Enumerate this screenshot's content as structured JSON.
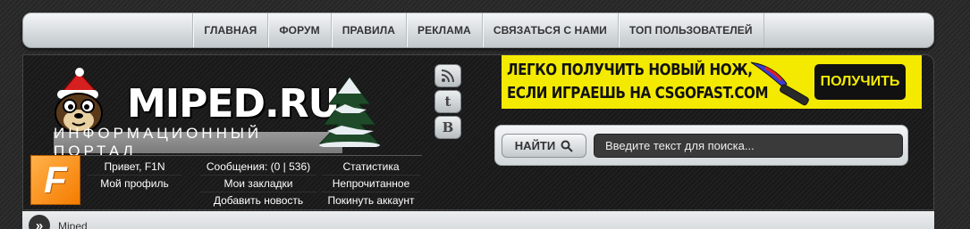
{
  "nav": {
    "items": [
      {
        "label": "ГЛАВНАЯ"
      },
      {
        "label": "ФОРУМ"
      },
      {
        "label": "ПРАВИЛА"
      },
      {
        "label": "РЕКЛАМА"
      },
      {
        "label": "СВЯЗАТЬСЯ С НАМИ"
      },
      {
        "label": "ТОП ПОЛЬЗОВАТЕЛЕЙ"
      }
    ]
  },
  "logo": {
    "title": "MIPED.RU",
    "subtitle": "ИНФОРМАЦИОННЫЙ ПОРТАЛ"
  },
  "social": {
    "rss_icon": "rss-icon",
    "twitter_label": "t",
    "vk_label": "B"
  },
  "ad": {
    "line1": "ЛЕГКО ПОЛУЧИТЬ НОВЫЙ НОЖ,",
    "line2": "ЕСЛИ ИГРАЕШЬ НА CSGOFAST.COM",
    "cta": "ПОЛУЧИТЬ",
    "colors": {
      "bg": "#f4ea00",
      "cta_bg": "#111111"
    }
  },
  "search": {
    "button_label": "НАЙТИ",
    "placeholder": "Введите текст для поиска..."
  },
  "user": {
    "avatar_letter": "F",
    "greeting": "Привет, F1N",
    "profile": "Мой профиль",
    "messages": "Сообщения: (0 | 536)",
    "bookmarks": "Мои закладки",
    "add_news": "Добавить новость",
    "stats": "Статистика",
    "unread": "Непрочитанное",
    "logout": "Покинуть аккаунт"
  },
  "breadcrumb": {
    "text": "Miped"
  }
}
